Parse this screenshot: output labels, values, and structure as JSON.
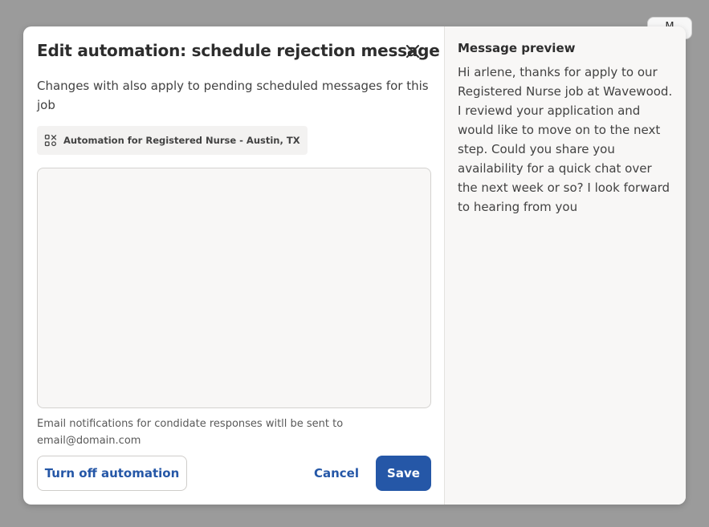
{
  "background": {
    "button_label": "M"
  },
  "modal": {
    "title": "Edit automation: schedule rejection message",
    "subtitle": "Changes with also apply to pending scheduled messages for this job",
    "chip": {
      "icon": "automation-flow-icon",
      "label": "Automation for Registered Nurse - Austin, TX"
    },
    "message_input": {
      "value": "",
      "placeholder": ""
    },
    "note": "Email notifications for condidate responses witll be sent to email@domain.com",
    "buttons": {
      "turn_off": "Turn off automation",
      "cancel": "Cancel",
      "save": "Save"
    }
  },
  "preview": {
    "title": "Message preview",
    "body": "Hi arlene, thanks for apply to our Registered Nurse job at Wavewood. I reviewd your application and would like to move on to the next step. Could you share you availability for a quick chat over the next week or so? I look forward to hearing from you"
  },
  "colors": {
    "primary": "#2557a7",
    "panel_bg": "#f8f7f6",
    "overlay": "#9b9b9b"
  }
}
